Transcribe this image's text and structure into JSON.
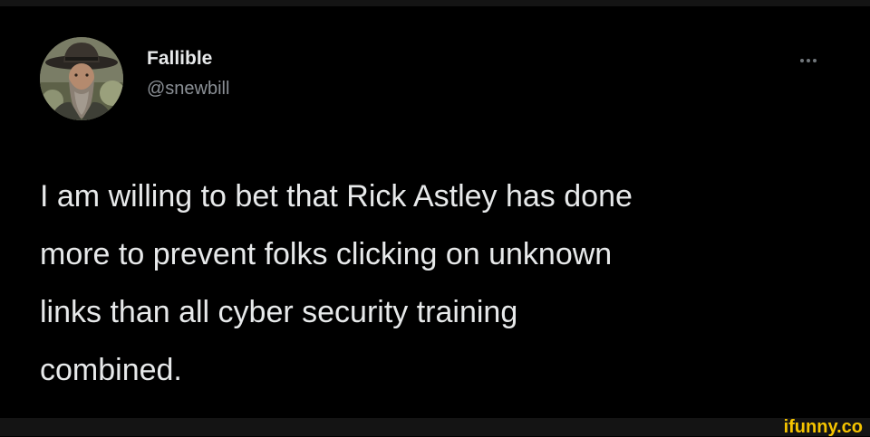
{
  "tweet": {
    "author": {
      "display_name": "Fallible",
      "handle": "@snewbill"
    },
    "text": "I am willing to bet that Rick Astley has done\nmore to prevent folks clicking on unknown\nlinks than all cyber security training\ncombined.",
    "more_icon": "ellipsis-icon"
  },
  "watermark": {
    "text": "ifunny.co",
    "color": "#f5c400"
  },
  "colors": {
    "background": "#000000",
    "primary_text": "#e7e9ea",
    "secondary_text": "#8b9096"
  }
}
